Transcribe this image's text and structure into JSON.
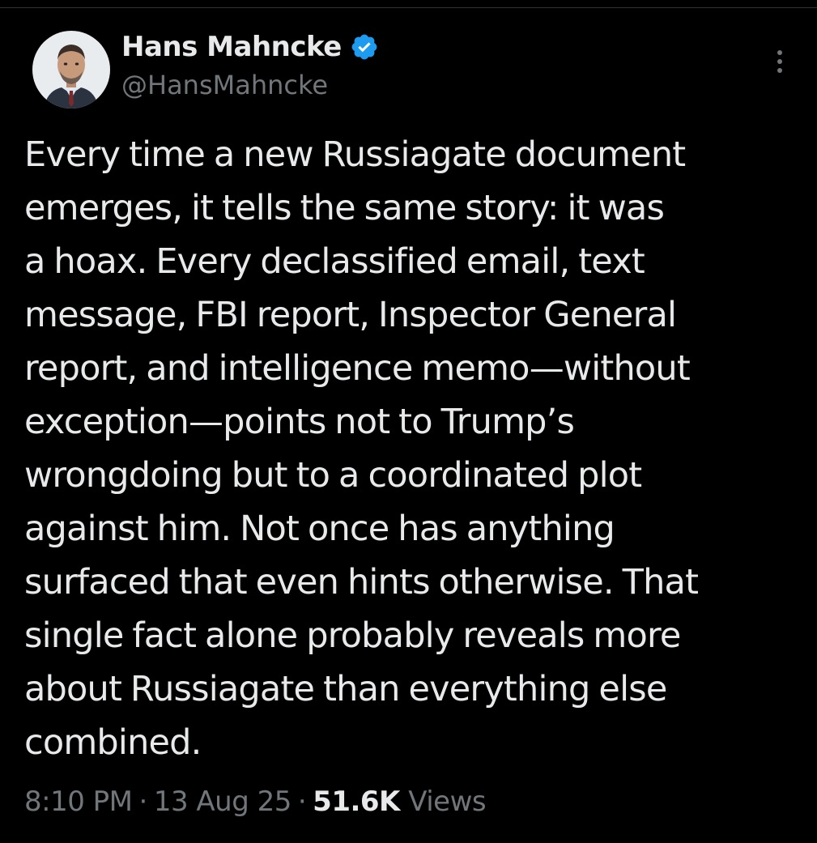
{
  "author": {
    "display_name": "Hans Mahncke",
    "handle": "@HansMahncke",
    "verified": true,
    "verified_color": "#1d9bf0"
  },
  "tweet": {
    "lines": [
      "Every time a new Russiagate document",
      "emerges, it tells the same story: it was",
      "a hoax. Every declassified email, text",
      "message, FBI report, Inspector General",
      "report, and intelligence memo—without",
      "exception—points not to Trump’s",
      "wrongdoing but to a coordinated plot",
      "against him. Not once has anything",
      "surfaced that even hints otherwise. That",
      "single fact alone probably reveals more",
      "about Russiagate than everything else",
      "combined."
    ]
  },
  "meta": {
    "time": "8:10 PM",
    "separator": "·",
    "date": "13 Aug 25",
    "views_count": "51.6K",
    "views_label": "Views"
  },
  "icons": {
    "more": "more-vertical-icon",
    "verified": "verified-badge-icon"
  },
  "colors": {
    "background": "#000000",
    "text_primary": "#e7e9ea",
    "text_secondary": "#71767b"
  }
}
